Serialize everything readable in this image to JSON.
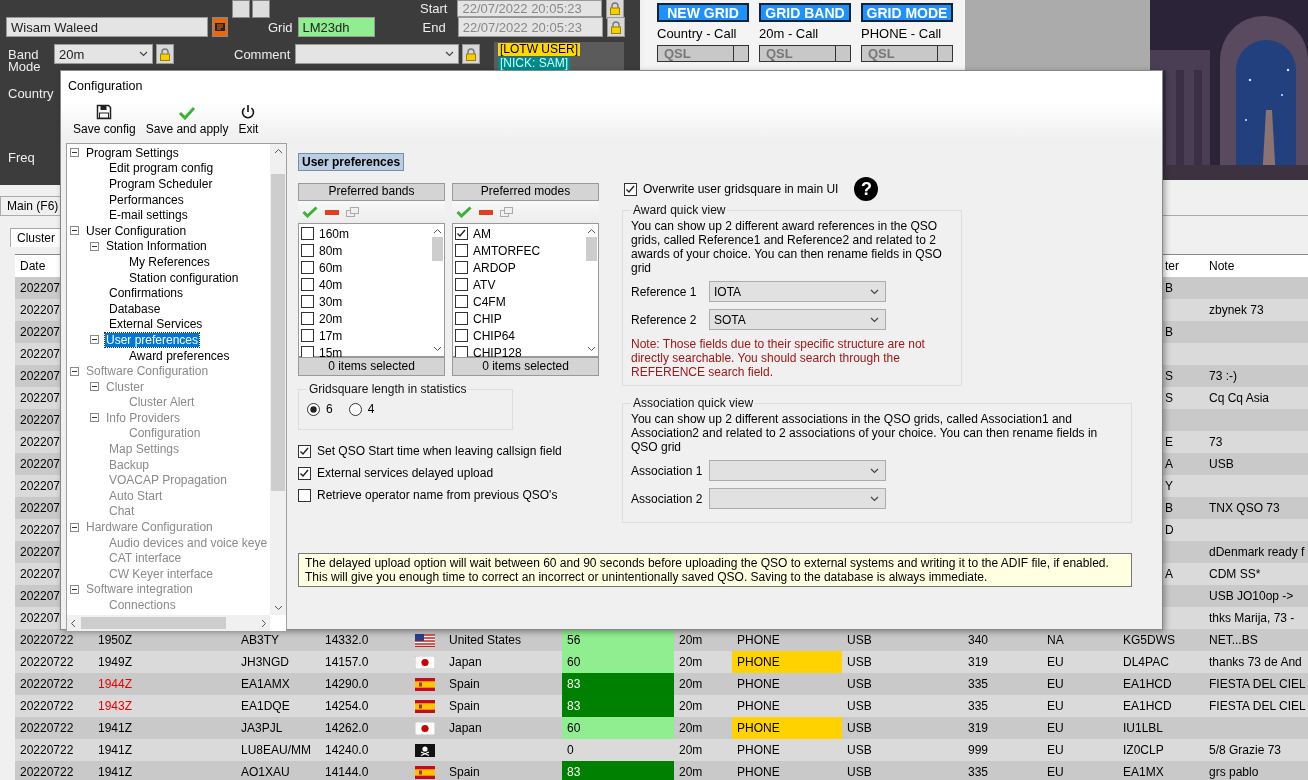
{
  "main_form": {
    "start_label": "Start",
    "start_value": "22/07/2022 20:05:23",
    "name_value": "Wisam Waleed",
    "grid_label": "Grid",
    "grid_value": "LM23dh",
    "end_label": "End",
    "end_value": "22/07/2022 20:05:23",
    "band_label": "Band",
    "band_value": "20m",
    "comment_label": "Comment",
    "mode_label": "Mode",
    "country_label": "Country",
    "freq_label": "Freq",
    "tags": [
      {
        "text": "[LOTW USER]",
        "color": "#ffd700"
      },
      {
        "text": "[NICK: SAM]",
        "color": "#008b8b"
      }
    ]
  },
  "grid_buttons": [
    {
      "label": "NEW GRID",
      "caption": "Country - Call",
      "qsl": "QSL"
    },
    {
      "label": "GRID BAND",
      "caption": "20m - Call",
      "qsl": "QSL"
    },
    {
      "label": "GRID MODE",
      "caption": "PHONE - Call",
      "qsl": "QSL"
    }
  ],
  "main_tab": "Main (F6)",
  "cluster_tab": "Cluster",
  "table": {
    "columns": {
      "date": "Date",
      "column_14": "ter",
      "note": "Note"
    },
    "rows": [
      {
        "date": "202207",
        "spotter": "B"
      },
      {
        "date": "202207",
        "note": "zbynek 73"
      },
      {
        "date": "202207",
        "spotter": "B"
      },
      {
        "date": "202207"
      },
      {
        "date": "202207",
        "spotter": "S",
        "note": "73 :-)"
      },
      {
        "date": "202207",
        "spotter": "S",
        "note": "Cq Cq Asia"
      },
      {
        "date": "202207"
      },
      {
        "date": "202207",
        "spotter": "E",
        "note": "73"
      },
      {
        "date": "202207",
        "spotter": "A",
        "note": "USB"
      },
      {
        "date": "202207",
        "spotter": "Y"
      },
      {
        "date": "202207",
        "spotter": "B",
        "note": "TNX QSO 73"
      },
      {
        "date": "202207",
        "spotter": "D"
      },
      {
        "date": "202207",
        "note": "dDenmark ready f"
      },
      {
        "date": "202207",
        "spotter": "A",
        "note": "CDM SS*"
      },
      {
        "date": "202207",
        "note": "USB JO10op ->"
      },
      {
        "date": "202207",
        "note": "thks Marija, 73 -"
      },
      {
        "date": "20220722",
        "time": "1950Z",
        "time_alert": false,
        "call": "AB3TY",
        "freq": "14332.0",
        "flag": {
          "kind": "us"
        },
        "country": "United States",
        "score": {
          "text": "56",
          "color": "#90ee90"
        },
        "band": "20m",
        "mode": "PHONE",
        "mode_highlight": false,
        "submode": "USB",
        "number": "340",
        "continent": "NA",
        "spotter": "KG5DWS",
        "note": "NET...BS"
      },
      {
        "date": "20220722",
        "time": "1949Z",
        "time_alert": false,
        "call": "JH3NGD",
        "freq": "14157.0",
        "flag": {
          "kind": "jp"
        },
        "country": "Japan",
        "score": {
          "text": "60",
          "color": "#90ee90"
        },
        "band": "20m",
        "mode": "PHONE",
        "mode_highlight": true,
        "submode": "USB",
        "number": "319",
        "continent": "EU",
        "spotter": "DL4PAC",
        "note": "thanks 73 de And"
      },
      {
        "date": "20220722",
        "time": "1944Z",
        "time_alert": true,
        "call": "EA1AMX",
        "freq": "14290.0",
        "flag": {
          "kind": "es"
        },
        "country": "Spain",
        "score": {
          "text": "83",
          "color": "#008000"
        },
        "band": "20m",
        "mode": "PHONE",
        "mode_highlight": false,
        "submode": "USB",
        "number": "335",
        "continent": "EU",
        "spotter": "EA1HCD",
        "note": "FIESTA DEL CIEL"
      },
      {
        "date": "20220722",
        "time": "1943Z",
        "time_alert": true,
        "call": "EA1DQE",
        "freq": "14254.0",
        "flag": {
          "kind": "es"
        },
        "country": "Spain",
        "score": {
          "text": "83",
          "color": "#008000"
        },
        "band": "20m",
        "mode": "PHONE",
        "mode_highlight": false,
        "submode": "USB",
        "number": "335",
        "continent": "EU",
        "spotter": "EA1HCD",
        "note": "FIESTA DEL CIEL"
      },
      {
        "date": "20220722",
        "time": "1941Z",
        "time_alert": false,
        "call": "JA3PJL",
        "freq": "14262.0",
        "flag": {
          "kind": "jp"
        },
        "country": "Japan",
        "score": {
          "text": "60",
          "color": "#90ee90"
        },
        "band": "20m",
        "mode": "PHONE",
        "mode_highlight": true,
        "submode": "USB",
        "number": "319",
        "continent": "EU",
        "spotter": "IU1LBL"
      },
      {
        "date": "20220722",
        "time": "1941Z",
        "time_alert": false,
        "call": "LU8EAU/MM",
        "freq": "14240.0",
        "flag": {
          "kind": "pirate"
        },
        "score": {
          "text": "0"
        },
        "band": "20m",
        "mode": "PHONE",
        "mode_highlight": false,
        "submode": "USB",
        "number": "999",
        "continent": "EU",
        "spotter": "IZ0CLP",
        "note": "5/8 Grazie 73"
      },
      {
        "date": "20220722",
        "time": "1941Z",
        "time_alert": false,
        "call": "AO1XAU",
        "freq": "14144.0",
        "flag": {
          "kind": "es"
        },
        "country": "Spain",
        "score": {
          "text": "83",
          "color": "#008000"
        },
        "band": "20m",
        "mode": "PHONE",
        "mode_highlight": false,
        "submode": "USB",
        "number": "335",
        "continent": "EU",
        "spotter": "EA1MX",
        "note": "grs pablo"
      }
    ]
  },
  "dialog": {
    "title": "Configuration",
    "toolbar": [
      {
        "kind": "save",
        "label": "Save config"
      },
      {
        "kind": "apply",
        "label": "Save and apply"
      },
      {
        "kind": "exit",
        "label": "Exit"
      }
    ],
    "tree": [
      {
        "label": "Program Settings",
        "dimmed": false,
        "selected": false,
        "expanded": true,
        "children": [
          {
            "label": "Edit program config",
            "selected": false
          },
          {
            "label": "Program Scheduler",
            "selected": false
          },
          {
            "label": "Performances",
            "selected": false
          },
          {
            "label": "E-mail settings",
            "selected": false
          }
        ]
      },
      {
        "label": "User Configuration",
        "dimmed": false,
        "selected": false,
        "expanded": true,
        "children": [
          {
            "label": "Station Information",
            "selected": false,
            "expanded": true,
            "children": [
              {
                "label": "My References",
                "selected": false
              },
              {
                "label": "Station configuration",
                "selected": false
              }
            ]
          },
          {
            "label": "Confirmations",
            "selected": false
          },
          {
            "label": "Database",
            "selected": false
          },
          {
            "label": "External Services",
            "selected": false
          },
          {
            "label": "User preferences",
            "selected": true,
            "expanded": true,
            "children": [
              {
                "label": "Award preferences",
                "selected": false
              }
            ]
          }
        ]
      },
      {
        "label": "Software Configuration",
        "dimmed": true,
        "selected": false,
        "expanded": true,
        "children": [
          {
            "label": "Cluster",
            "selected": false,
            "expanded": true,
            "children": [
              {
                "label": "Cluster Alert",
                "selected": false
              }
            ]
          },
          {
            "label": "Info Providers",
            "selected": false,
            "expanded": true,
            "children": [
              {
                "label": "Configuration",
                "selected": false
              }
            ]
          },
          {
            "label": "Map Settings",
            "selected": false
          },
          {
            "label": "Backup",
            "selected": false
          },
          {
            "label": "VOACAP Propagation",
            "selected": false
          },
          {
            "label": "Auto Start",
            "selected": false
          },
          {
            "label": "Chat",
            "selected": false
          }
        ]
      },
      {
        "label": "Hardware Configuration",
        "dimmed": true,
        "selected": false,
        "expanded": true,
        "children": [
          {
            "label": "Audio devices and voice keye",
            "selected": false
          },
          {
            "label": "CAT interface",
            "selected": false
          },
          {
            "label": "CW Keyer interface",
            "selected": false
          }
        ]
      },
      {
        "label": "Software integration",
        "dimmed": true,
        "selected": false,
        "expanded": true,
        "children": [
          {
            "label": "Connections",
            "selected": false
          }
        ]
      }
    ],
    "page_title": "User preferences",
    "lists": [
      {
        "title": "Preferred bands",
        "footer": "0 items selected",
        "items": [
          {
            "label": "160m",
            "checked": false
          },
          {
            "label": "80m",
            "checked": false
          },
          {
            "label": "60m",
            "checked": false
          },
          {
            "label": "40m",
            "checked": false
          },
          {
            "label": "30m",
            "checked": false
          },
          {
            "label": "20m",
            "checked": false
          },
          {
            "label": "17m",
            "checked": false
          },
          {
            "label": "15m",
            "checked": false
          }
        ]
      },
      {
        "title": "Preferred modes",
        "footer": "0 items selected",
        "items": [
          {
            "label": "AM",
            "checked": true
          },
          {
            "label": "AMTORFEC",
            "checked": false
          },
          {
            "label": "ARDOP",
            "checked": false
          },
          {
            "label": "ATV",
            "checked": false
          },
          {
            "label": "C4FM",
            "checked": false
          },
          {
            "label": "CHIP",
            "checked": false
          },
          {
            "label": "CHIP64",
            "checked": false
          },
          {
            "label": "CHIP128",
            "checked": false
          }
        ]
      }
    ],
    "gridsquare": {
      "title": "Gridsquare length in statistics",
      "options": [
        {
          "label": "6",
          "selected": true
        },
        {
          "label": "4",
          "selected": false
        }
      ]
    },
    "options": [
      {
        "label": "Set QSO Start time when leaving callsign field",
        "checked": true
      },
      {
        "label": "External services delayed upload",
        "checked": true
      },
      {
        "label": "Retrieve operator name from previous QSO's",
        "checked": false
      }
    ],
    "overwrite": {
      "label": "Overwrite user gridsquare in main UI",
      "checked": true
    },
    "help": "?",
    "award": {
      "title": "Award quick view",
      "text": "You can show up 2 different award references in the QSO grids, called Reference1 and Reference2 and related to 2 awards of your choice. You can then rename fields in QSO grid",
      "fields": [
        {
          "label": "Reference 1",
          "value": "IOTA"
        },
        {
          "label": "Reference 2",
          "value": "SOTA"
        }
      ],
      "note": "Note: Those fields due to their specific structure are not directly searchable. You should search through the REFERENCE search field."
    },
    "association": {
      "title": "Association quick view",
      "text": "You can show up 2 different associations in the QSO grids, called Association1 and Association2 and related to 2 associations of your choice. You can then rename fields in QSO grid",
      "fields": [
        {
          "label": "Association 1"
        },
        {
          "label": "Association 2"
        }
      ]
    },
    "info": "The delayed upload option will wait between 60 and 90 seconds before uploading the QSO to external systems and writing it to the ADIF file, if enabled. This will give you enough time to correct an incorrect or unintentionally saved QSO. Saving to the database is always immediate."
  }
}
